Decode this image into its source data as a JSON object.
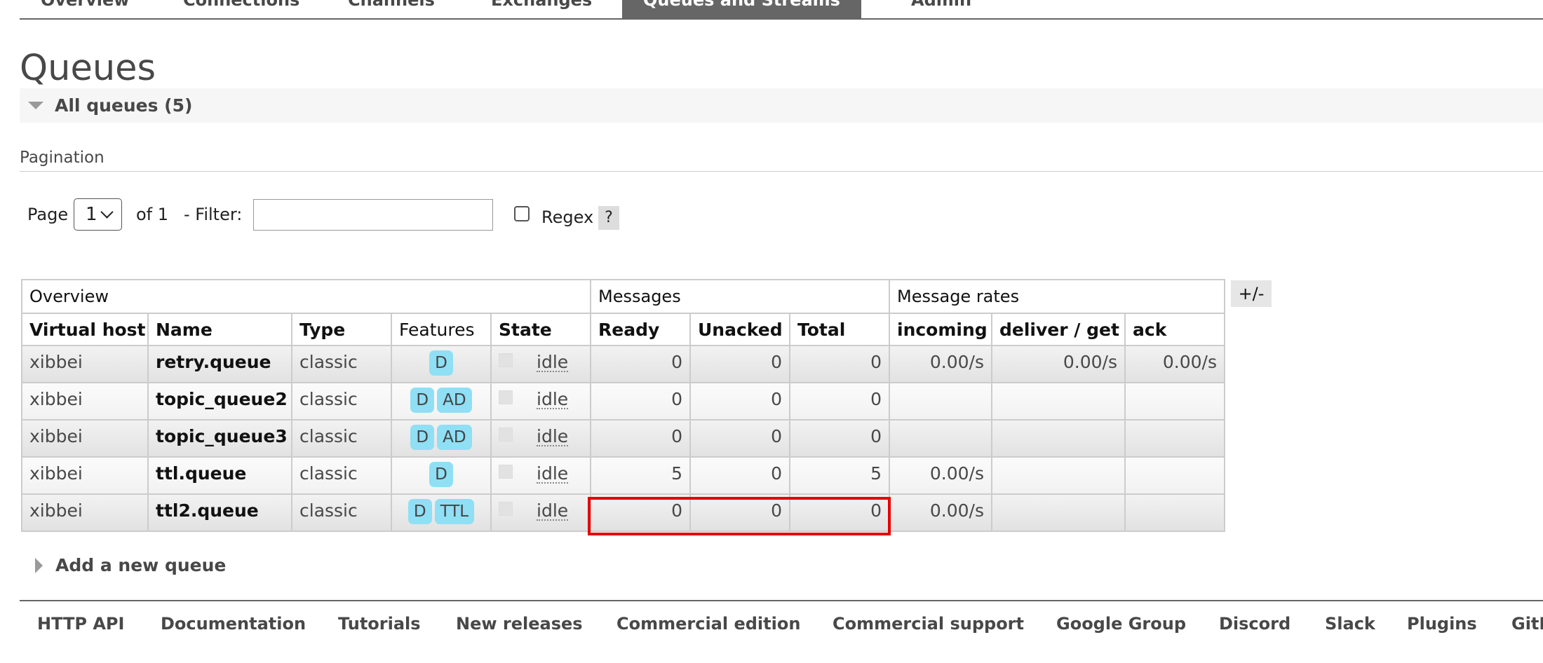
{
  "nav": {
    "tabs": [
      {
        "label": "Overview",
        "active": false
      },
      {
        "label": "Connections",
        "active": false
      },
      {
        "label": "Channels",
        "active": false
      },
      {
        "label": "Exchanges",
        "active": false
      },
      {
        "label": "Queues and Streams",
        "active": true
      },
      {
        "label": "Admin",
        "active": false
      }
    ]
  },
  "page_title": "Queues",
  "all_queues_label": "All queues (5)",
  "pagination": {
    "title": "Pagination",
    "page_label": "Page",
    "page_value": "1",
    "of_label": "of 1",
    "filter_label": "- Filter:",
    "filter_value": "",
    "regex_label": "Regex",
    "regex_checked": false,
    "help_label": "?"
  },
  "table": {
    "groups": [
      "Overview",
      "Messages",
      "Message rates"
    ],
    "columns": [
      "Virtual host",
      "Name",
      "Type",
      "Features",
      "State",
      "Ready",
      "Unacked",
      "Total",
      "incoming",
      "deliver / get",
      "ack"
    ],
    "toggle_label": "+/-",
    "rows": [
      {
        "vhost": "xibbei",
        "name": "retry.queue",
        "type": "classic",
        "features": [
          "D"
        ],
        "state": "idle",
        "ready": "0",
        "unacked": "0",
        "total": "0",
        "incoming": "0.00/s",
        "deliver": "0.00/s",
        "ack": "0.00/s"
      },
      {
        "vhost": "xibbei",
        "name": "topic_queue2",
        "type": "classic",
        "features": [
          "D",
          "AD"
        ],
        "state": "idle",
        "ready": "0",
        "unacked": "0",
        "total": "0",
        "incoming": "",
        "deliver": "",
        "ack": ""
      },
      {
        "vhost": "xibbei",
        "name": "topic_queue3",
        "type": "classic",
        "features": [
          "D",
          "AD"
        ],
        "state": "idle",
        "ready": "0",
        "unacked": "0",
        "total": "0",
        "incoming": "",
        "deliver": "",
        "ack": ""
      },
      {
        "vhost": "xibbei",
        "name": "ttl.queue",
        "type": "classic",
        "features": [
          "D"
        ],
        "state": "idle",
        "ready": "5",
        "unacked": "0",
        "total": "5",
        "incoming": "0.00/s",
        "deliver": "",
        "ack": ""
      },
      {
        "vhost": "xibbei",
        "name": "ttl2.queue",
        "type": "classic",
        "features": [
          "D",
          "TTL"
        ],
        "state": "idle",
        "ready": "0",
        "unacked": "0",
        "total": "0",
        "incoming": "0.00/s",
        "deliver": "",
        "ack": ""
      }
    ]
  },
  "add_queue_label": "Add a new queue",
  "footer_links": [
    "HTTP API",
    "Documentation",
    "Tutorials",
    "New releases",
    "Commercial edition",
    "Commercial support",
    "Google Group",
    "Discord",
    "Slack",
    "Plugins",
    "GitHub"
  ],
  "colors": {
    "highlight": "#e60000",
    "badge": "#8fdff5",
    "active_tab": "#666666"
  }
}
